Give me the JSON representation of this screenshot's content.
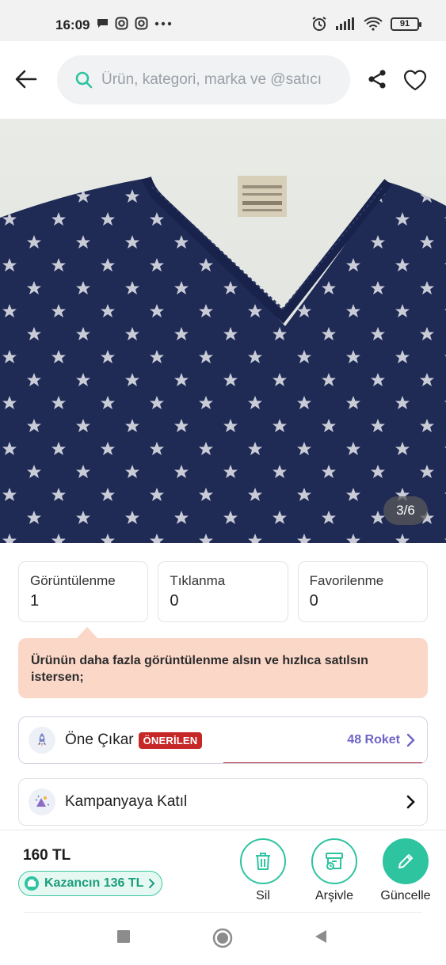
{
  "status_bar": {
    "time": "16:09",
    "battery": "91",
    "left_icons": [
      "chat-bubble-icon",
      "instagram-icon",
      "instagram-icon",
      "more-dots-icon"
    ],
    "right_icons": [
      "alarm-icon",
      "signal-icon",
      "wifi-icon",
      "battery-icon"
    ]
  },
  "header": {
    "search_placeholder": "Ürün, kategori, marka ve @satıcı"
  },
  "product_image": {
    "pager": "3/6",
    "shirt_color": "#1f2a55"
  },
  "stats": [
    {
      "label": "Görüntülenme",
      "value": "1"
    },
    {
      "label": "Tıklanma",
      "value": "0"
    },
    {
      "label": "Favorilenme",
      "value": "0"
    }
  ],
  "tip": {
    "text": "Ürünün daha fazla görüntülenme alsın ve hızlıca satılsın istersen;"
  },
  "options": {
    "boost": {
      "label": "Öne Çıkar",
      "badge": "ÖNERİLEN",
      "price": "48 Roket"
    },
    "campaign": {
      "label": "Kampanyaya Katıl"
    }
  },
  "bottom_bar": {
    "price": "160 TL",
    "earning": "Kazancın 136 TL",
    "actions": {
      "delete": "Sil",
      "archive": "Arşivle",
      "update": "Güncelle"
    }
  },
  "colors": {
    "accent": "#2ec4a0",
    "badge": "#c62828",
    "roket": "#6e64c8",
    "tip_bg": "#fbd7c8"
  }
}
